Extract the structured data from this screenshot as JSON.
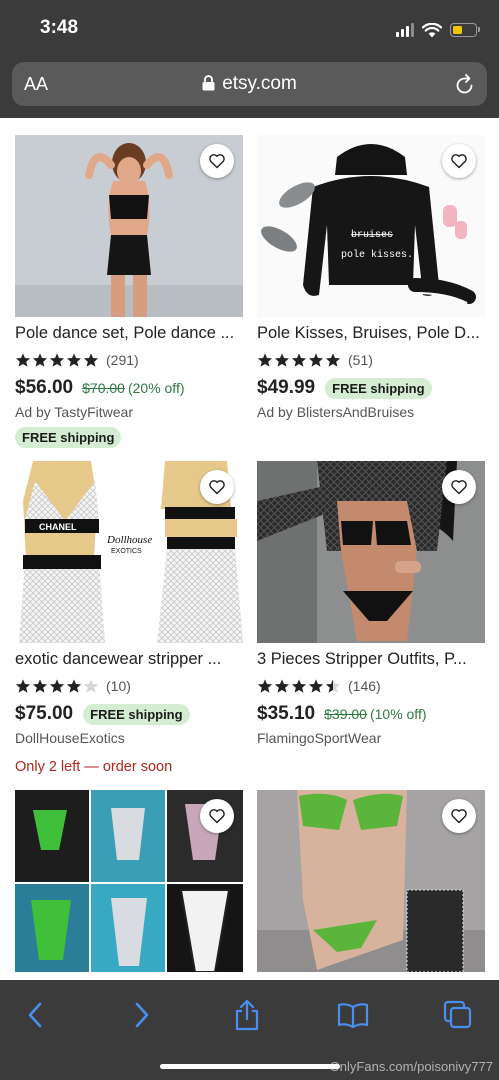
{
  "status_bar": {
    "time": "3:48"
  },
  "url_bar": {
    "text_size_label": "AA",
    "domain": "etsy.com"
  },
  "products": [
    {
      "title": "Pole dance set, Pole dance ...",
      "stars": 5,
      "reviews": "(291)",
      "price": "$56.00",
      "original_price": "$70.00",
      "discount": "(20% off)",
      "shop": "Ad by TastyFitwear",
      "free_shipping": "FREE shipping"
    },
    {
      "title": "Pole Kisses, Bruises, Pole D...",
      "stars": 5,
      "reviews": "(51)",
      "price": "$49.99",
      "free_shipping": "FREE shipping",
      "shop": "Ad by BlistersAndBruises",
      "image_text": {
        "strike": "bruises",
        "line": "pole kisses."
      }
    },
    {
      "title": "exotic dancewear stripper ...",
      "stars": 4,
      "reviews": "(10)",
      "price": "$75.00",
      "free_shipping": "FREE shipping",
      "shop": "DollHouseExotics",
      "urgency": "Only 2 left — order soon",
      "image_text": {
        "brand": "CHANEL",
        "logo_top": "Dollhouse",
        "logo_bottom": "EXOTICS"
      }
    },
    {
      "title": "3 Pieces Stripper Outfits, P...",
      "stars": 4.5,
      "reviews": "(146)",
      "price": "$35.10",
      "original_price": "$39.00",
      "discount": "(10% off)",
      "shop": "FlamingoSportWear"
    }
  ],
  "watermark": "OnlyFans.com/poisonivy777",
  "colors": {
    "chrome": "#3b3b3b",
    "url_bar": "#5a5a5a",
    "toolbar_icons": "#4a8ff0",
    "discount_green": "#2f7a3f",
    "pill_bg": "#d4ecd2",
    "urgency_red": "#b3261e"
  },
  "icons": [
    "lock-icon",
    "reload-icon",
    "heart-icon",
    "star-icon",
    "back-icon",
    "forward-icon",
    "share-icon",
    "bookmarks-icon",
    "tabs-icon"
  ]
}
